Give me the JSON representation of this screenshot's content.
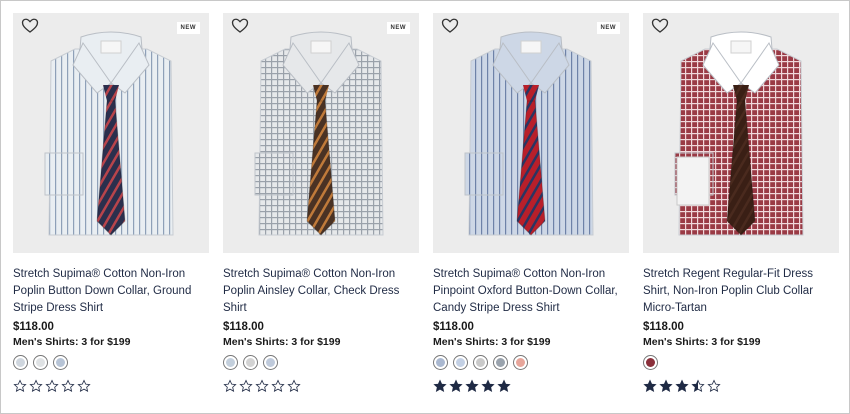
{
  "products": [
    {
      "title": "Stretch Supima® Cotton Non-Iron Poplin Button Down Collar, Ground Stripe Dress Shirt",
      "price": "$118.00",
      "promo": "Men's Shirts: 3 for $199",
      "badge": "NEW",
      "shirt_color": "#e9eef2",
      "stripe_color": "#8ea0b8",
      "tie_color": "#2b2f4d",
      "tie_accent": "#b8444b",
      "collar_color": "#e9eef2",
      "swatches": [
        "#cfd6de",
        "#dfe2e4",
        "#b7c4d6"
      ],
      "rating": 0
    },
    {
      "title": "Stretch Supima® Cotton Non-Iron Poplin Ainsley Collar, Check Dress Shirt",
      "price": "$118.00",
      "promo": "Men's Shirts: 3 for $199",
      "badge": "NEW",
      "shirt_color": "#e6e8ea",
      "stripe_color": "#9aa1aa",
      "tie_color": "#4a3224",
      "tie_accent": "#c07a3a",
      "collar_color": "#e6e8ea",
      "swatches": [
        "#c3cfdc",
        "#d3d3d3",
        "#bfcadb"
      ],
      "rating": 0
    },
    {
      "title": "Stretch Supima® Cotton Non-Iron Pinpoint Oxford Button-Down Collar, Candy Stripe Dress Shirt",
      "price": "$118.00",
      "promo": "Men's Shirts: 3 for $199",
      "badge": "NEW",
      "shirt_color": "#cdd7e6",
      "stripe_color": "#6e82a8",
      "tie_color": "#b81f2a",
      "tie_accent": "#2a3562",
      "collar_color": "#cdd7e6",
      "swatches": [
        "#aab8d0",
        "#c3d0e4",
        "#c9c9c9",
        "#9aa3ad",
        "#e7a59a"
      ],
      "rating": 5
    },
    {
      "title": "Stretch Regent Regular-Fit Dress Shirt, Non-Iron Poplin Club Collar Micro-Tartan",
      "price": "$118.00",
      "promo": "Men's Shirts: 3 for $199",
      "badge": "",
      "shirt_color": "#9a3a45",
      "stripe_color": "#f0d7da",
      "tie_color": "#3a1f15",
      "tie_accent": "#4a2a1e",
      "collar_color": "#ffffff",
      "swatches": [
        "#8a2f3a"
      ],
      "rating": 3.5
    }
  ]
}
